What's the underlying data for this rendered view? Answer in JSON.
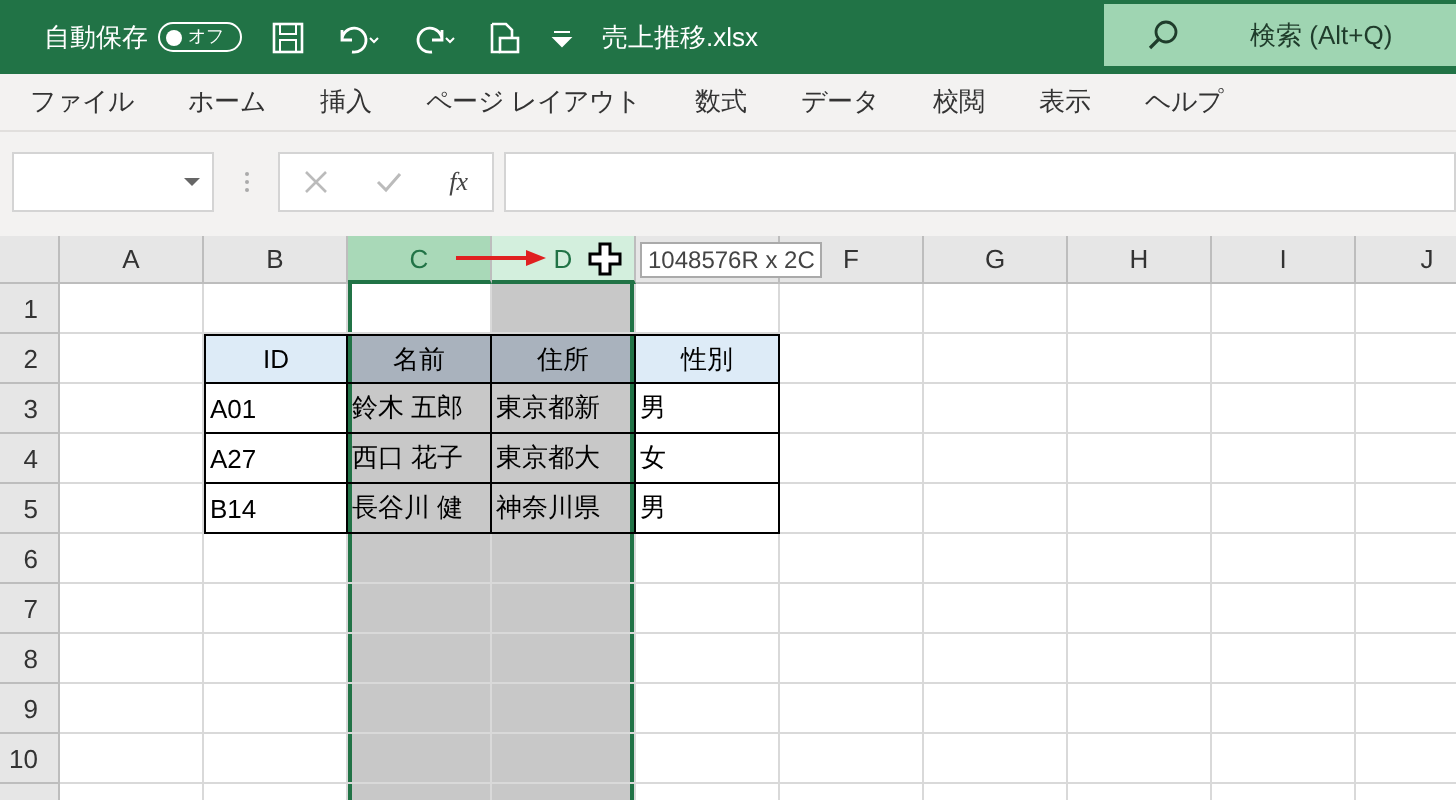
{
  "title_bar": {
    "autosave_label": "自動保存",
    "autosave_on": false,
    "autosave_state": "オフ",
    "file_name": "売上推移.xlsx",
    "search_placeholder": "検索 (Alt+Q)"
  },
  "ribbon_tabs": [
    "ファイル",
    "ホーム",
    "挿入",
    "ページ レイアウト",
    "数式",
    "データ",
    "校閲",
    "表示",
    "ヘルプ"
  ],
  "formula_bar": {
    "function_label": "fx"
  },
  "sheet": {
    "columns": [
      {
        "label": "A",
        "selected": false,
        "active": false
      },
      {
        "label": "B",
        "selected": false,
        "active": false
      },
      {
        "label": "C",
        "selected": true,
        "active": true
      },
      {
        "label": "D",
        "selected": true,
        "active": false
      },
      {
        "selected": false,
        "active": false
      },
      {
        "label": "F",
        "selected": false,
        "active": false
      },
      {
        "label": "G",
        "selected": false,
        "active": false
      },
      {
        "label": "H",
        "selected": false,
        "active": false
      },
      {
        "label": "I",
        "selected": false,
        "active": false
      },
      {
        "label": "J",
        "selected": false,
        "active": false
      }
    ],
    "rows": [
      "1",
      "2",
      "3",
      "4",
      "5",
      "6",
      "7",
      "8",
      "9",
      "10"
    ],
    "selection_tooltip": "1048576R x 2C",
    "table": {
      "header": [
        "ID",
        "名前",
        "住所",
        "性別"
      ],
      "rows": [
        [
          "A01",
          "鈴木 五郎",
          "東京都新",
          "男"
        ],
        [
          "A27",
          "西口 花子",
          "東京都大",
          "女"
        ],
        [
          "B14",
          "長谷川 健",
          "神奈川県",
          "男"
        ]
      ]
    }
  }
}
